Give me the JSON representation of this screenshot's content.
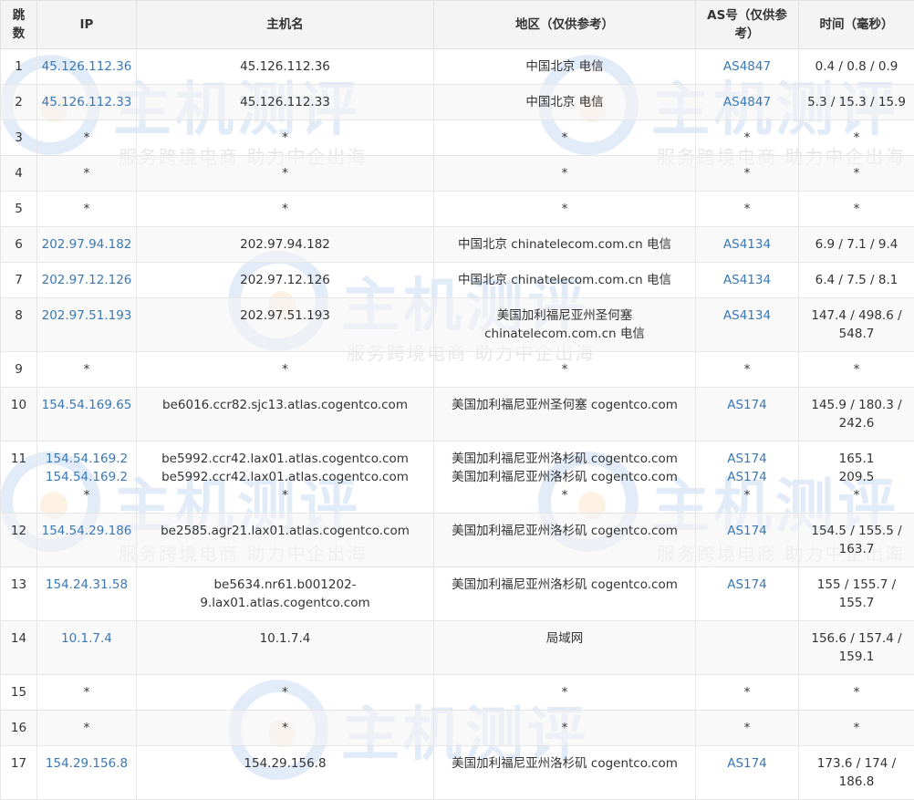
{
  "watermark": {
    "brand": "主机测评",
    "slogan": "服务跨境电商 助力中企出海"
  },
  "columns": [
    "跳数",
    "IP",
    "主机名",
    "地区（仅供参考）",
    "AS号（仅供参考）",
    "时间（毫秒）"
  ],
  "rows": [
    {
      "hop": "1",
      "ip": [
        "45.126.112.36"
      ],
      "host": [
        "45.126.112.36"
      ],
      "region": [
        "中国北京 电信"
      ],
      "as": [
        "AS4847"
      ],
      "time": [
        "0.4 / 0.8 / 0.9"
      ]
    },
    {
      "hop": "2",
      "ip": [
        "45.126.112.33"
      ],
      "host": [
        "45.126.112.33"
      ],
      "region": [
        "中国北京 电信"
      ],
      "as": [
        "AS4847"
      ],
      "time": [
        "5.3 / 15.3 / 15.9"
      ]
    },
    {
      "hop": "3",
      "ip": [
        "*"
      ],
      "host": [
        "*"
      ],
      "region": [
        "*"
      ],
      "as": [
        "*"
      ],
      "time": [
        "*"
      ]
    },
    {
      "hop": "4",
      "ip": [
        "*"
      ],
      "host": [
        "*"
      ],
      "region": [
        "*"
      ],
      "as": [
        "*"
      ],
      "time": [
        "*"
      ]
    },
    {
      "hop": "5",
      "ip": [
        "*"
      ],
      "host": [
        "*"
      ],
      "region": [
        "*"
      ],
      "as": [
        "*"
      ],
      "time": [
        "*"
      ]
    },
    {
      "hop": "6",
      "ip": [
        "202.97.94.182"
      ],
      "host": [
        "202.97.94.182"
      ],
      "region": [
        "中国北京 chinatelecom.com.cn 电信"
      ],
      "as": [
        "AS4134"
      ],
      "time": [
        "6.9 / 7.1 / 9.4"
      ]
    },
    {
      "hop": "7",
      "ip": [
        "202.97.12.126"
      ],
      "host": [
        "202.97.12.126"
      ],
      "region": [
        "中国北京 chinatelecom.com.cn 电信"
      ],
      "as": [
        "AS4134"
      ],
      "time": [
        "6.4 / 7.5 / 8.1"
      ]
    },
    {
      "hop": "8",
      "ip": [
        "202.97.51.193"
      ],
      "host": [
        "202.97.51.193"
      ],
      "region": [
        "美国加利福尼亚州圣何塞",
        "chinatelecom.com.cn 电信"
      ],
      "as": [
        "AS4134"
      ],
      "time": [
        "147.4 / 498.6 /",
        "548.7"
      ]
    },
    {
      "hop": "9",
      "ip": [
        "*"
      ],
      "host": [
        "*"
      ],
      "region": [
        "*"
      ],
      "as": [
        "*"
      ],
      "time": [
        "*"
      ]
    },
    {
      "hop": "10",
      "ip": [
        "154.54.169.65"
      ],
      "host": [
        "be6016.ccr82.sjc13.atlas.cogentco.com"
      ],
      "region": [
        "美国加利福尼亚州圣何塞 cogentco.com"
      ],
      "as": [
        "AS174"
      ],
      "time": [
        "145.9 / 180.3 /",
        "242.6"
      ]
    },
    {
      "hop": "11",
      "ip": [
        "154.54.169.2",
        "154.54.169.2",
        "*"
      ],
      "host": [
        "be5992.ccr42.lax01.atlas.cogentco.com",
        "be5992.ccr42.lax01.atlas.cogentco.com",
        "*"
      ],
      "region": [
        "美国加利福尼亚州洛杉矶 cogentco.com",
        "美国加利福尼亚州洛杉矶 cogentco.com",
        "*"
      ],
      "as": [
        "AS174",
        "AS174",
        "*"
      ],
      "time": [
        "165.1",
        "209.5",
        "*"
      ]
    },
    {
      "hop": "12",
      "ip": [
        "154.54.29.186"
      ],
      "host": [
        "be2585.agr21.lax01.atlas.cogentco.com"
      ],
      "region": [
        "美国加利福尼亚州洛杉矶 cogentco.com"
      ],
      "as": [
        "AS174"
      ],
      "time": [
        "154.5 / 155.5 /",
        "163.7"
      ]
    },
    {
      "hop": "13",
      "ip": [
        "154.24.31.58"
      ],
      "host": [
        "be5634.nr61.b001202-",
        "9.lax01.atlas.cogentco.com"
      ],
      "region": [
        "美国加利福尼亚州洛杉矶 cogentco.com"
      ],
      "as": [
        "AS174"
      ],
      "time": [
        "155 / 155.7 /",
        "155.7"
      ]
    },
    {
      "hop": "14",
      "ip": [
        "10.1.7.4"
      ],
      "host": [
        "10.1.7.4"
      ],
      "region": [
        "局域网"
      ],
      "as": [
        ""
      ],
      "time": [
        "156.6 / 157.4 /",
        "159.1"
      ]
    },
    {
      "hop": "15",
      "ip": [
        "*"
      ],
      "host": [
        "*"
      ],
      "region": [
        "*"
      ],
      "as": [
        "*"
      ],
      "time": [
        "*"
      ]
    },
    {
      "hop": "16",
      "ip": [
        "*"
      ],
      "host": [
        "*"
      ],
      "region": [
        "*"
      ],
      "as": [
        "*"
      ],
      "time": [
        "*"
      ]
    },
    {
      "hop": "17",
      "ip": [
        "154.29.156.8"
      ],
      "host": [
        "154.29.156.8"
      ],
      "region": [
        "美国加利福尼亚州洛杉矶 cogentco.com"
      ],
      "as": [
        "AS174"
      ],
      "time": [
        "173.6 / 174 /",
        "186.8"
      ]
    }
  ]
}
